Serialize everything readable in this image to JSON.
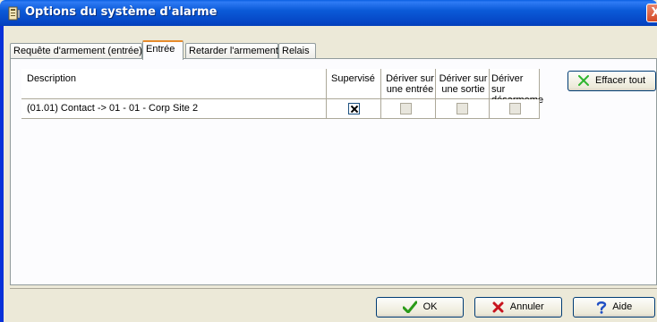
{
  "window": {
    "title": "Options du système d'alarme",
    "close_glyph": "X"
  },
  "tabs": [
    {
      "label": "Requête d'armement (entrée)",
      "active": false
    },
    {
      "label": "Entrée",
      "active": true
    },
    {
      "label": "Retarder l'armement",
      "active": false
    },
    {
      "label": "Relais",
      "active": false
    }
  ],
  "table": {
    "headers": {
      "description": "Description",
      "supervised": "Supervisé",
      "derive_input": [
        "Dériver sur",
        "une entrée"
      ],
      "derive_output": [
        "Dériver sur",
        "une sortie"
      ],
      "derive_disarm": [
        "Dériver sur",
        "désarmeme"
      ]
    },
    "rows": [
      {
        "description": "(01.01) Contact -> 01 - 01 - Corp Site 2",
        "supervised": true,
        "derive_input": false,
        "derive_output": false,
        "derive_disarm": false
      }
    ]
  },
  "buttons": {
    "clear_all": "Effacer tout",
    "ok": "OK",
    "cancel": "Annuler",
    "help": "Aide"
  },
  "icons": {
    "clear_all": "green-x-icon",
    "ok": "green-check-icon",
    "cancel": "red-x-icon",
    "help": "blue-question-icon"
  },
  "colors": {
    "titlebar": "#0545c4",
    "active_tab_accent": "#e68b2c",
    "ok_check": "#2a9a18",
    "cancel_x": "#c8141e",
    "help_q": "#1f4fc4",
    "clear_x": "#2fb52f"
  }
}
